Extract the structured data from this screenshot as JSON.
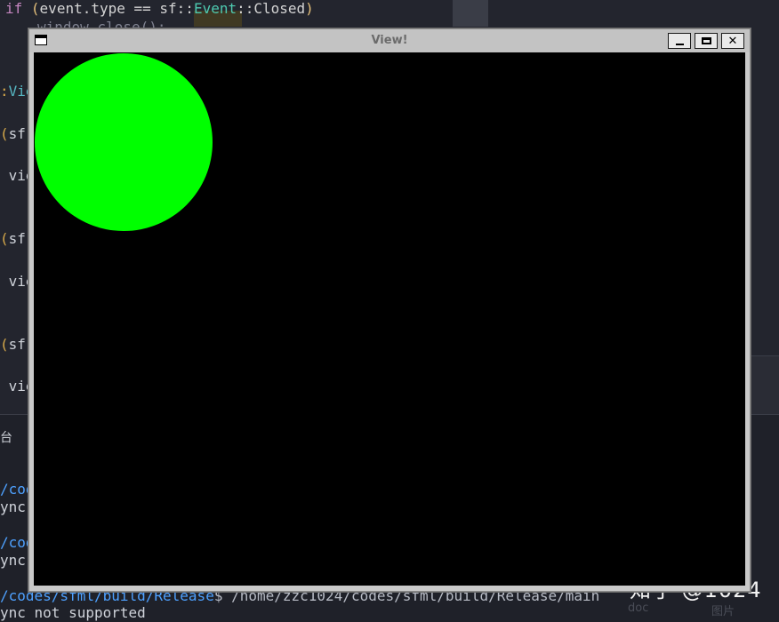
{
  "editor": {
    "line1": {
      "if": "if",
      "open": "(",
      "expr": "event.type == sf::",
      "ns": "Event",
      "sep": "::",
      "closed": "Closed",
      "close": ")"
    },
    "line2": "window.close();",
    "edge_lines": [
      {
        "prefix": ":",
        "text": "Vie"
      },
      {
        "prefix": "(",
        "text": "sf:"
      },
      {
        "prefix": " ",
        "text": "vie"
      },
      {
        "prefix": "(",
        "text": "sf:"
      },
      {
        "prefix": " ",
        "text": "vie"
      },
      {
        "prefix": "(",
        "text": "sf:"
      },
      {
        "prefix": " ",
        "text": "vie"
      }
    ]
  },
  "terminal": {
    "tab_fragment": "台",
    "lines": [
      {
        "path": "/codes",
        "rest": ""
      },
      {
        "path": "",
        "rest": "ync n"
      },
      {
        "path": "/codes",
        "rest": ""
      },
      {
        "path": "",
        "rest": "ync n"
      }
    ],
    "prompt_path": "/codes/sfml/build/Release",
    "prompt_cmd": "$ /home/zzc1024/codes/sfml/build/Release/main",
    "last_line": "ync not supported",
    "faint_right": [
      "doc",
      "图片"
    ]
  },
  "window": {
    "title": "View!",
    "minimize_label": "minimize",
    "maximize_label": "maximize",
    "close_symbol": "✕",
    "circle_color": "#00ff00",
    "canvas_color": "#000000"
  },
  "watermark": "知乎 @1024"
}
